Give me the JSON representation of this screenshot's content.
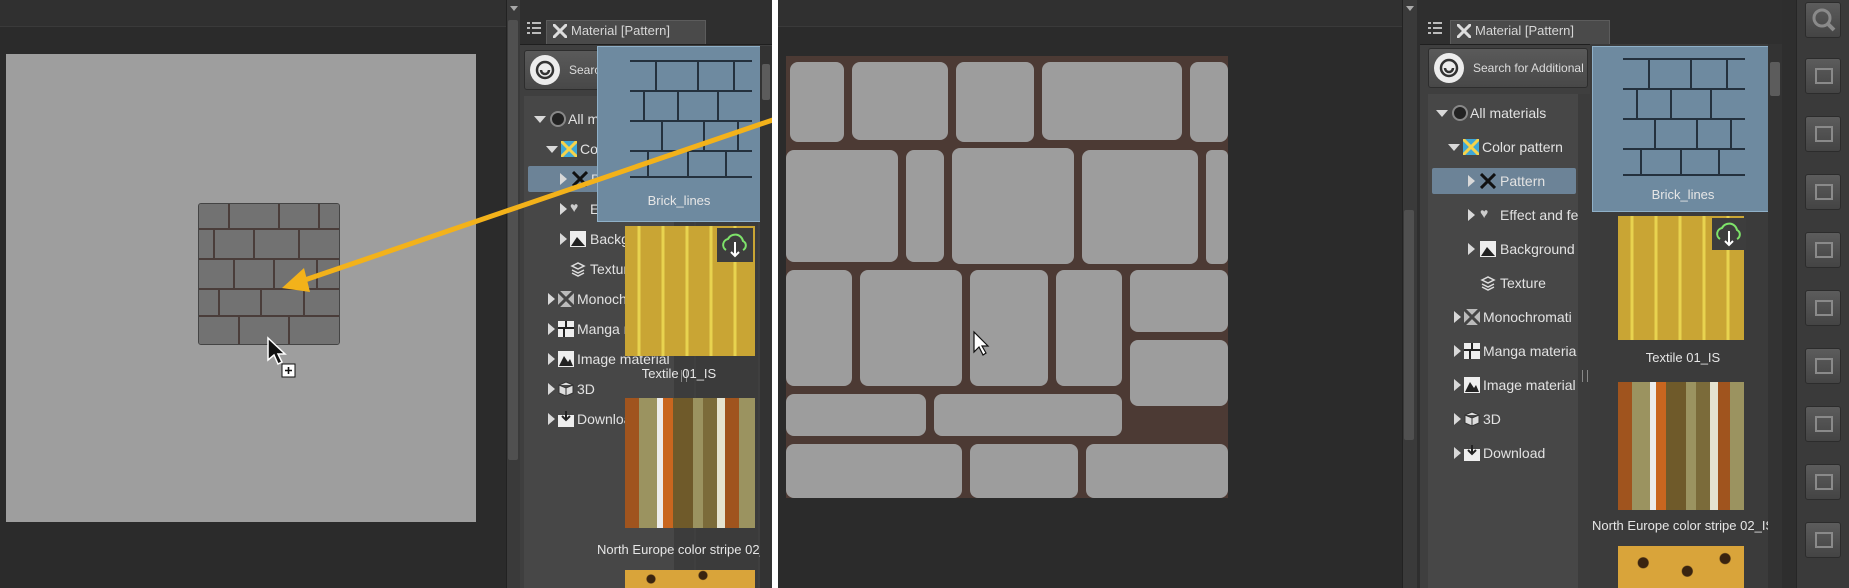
{
  "tab_title": "Material [Pattern]",
  "search_button_label": "Search for Additional Ma",
  "tree": {
    "all_materials": "All materials",
    "color_pattern": "Color pattern",
    "pattern": "Pattern",
    "effect": "Effect and fe",
    "background": "Background",
    "texture": "Texture",
    "monochromatic": "Monochromati",
    "manga": "Manga materia",
    "image": "Image material",
    "three_d": "3D",
    "download": "Download"
  },
  "thumbnails": {
    "brick": "Brick_lines",
    "textile": "Textile 01_IS",
    "stripe": "North Europe color stripe 02_IS"
  },
  "colors": {
    "arrow": "#f3b21a",
    "selection": "#6c8397",
    "canvas": "#9d9d9d",
    "brick_mortar": "#4c3a34"
  }
}
